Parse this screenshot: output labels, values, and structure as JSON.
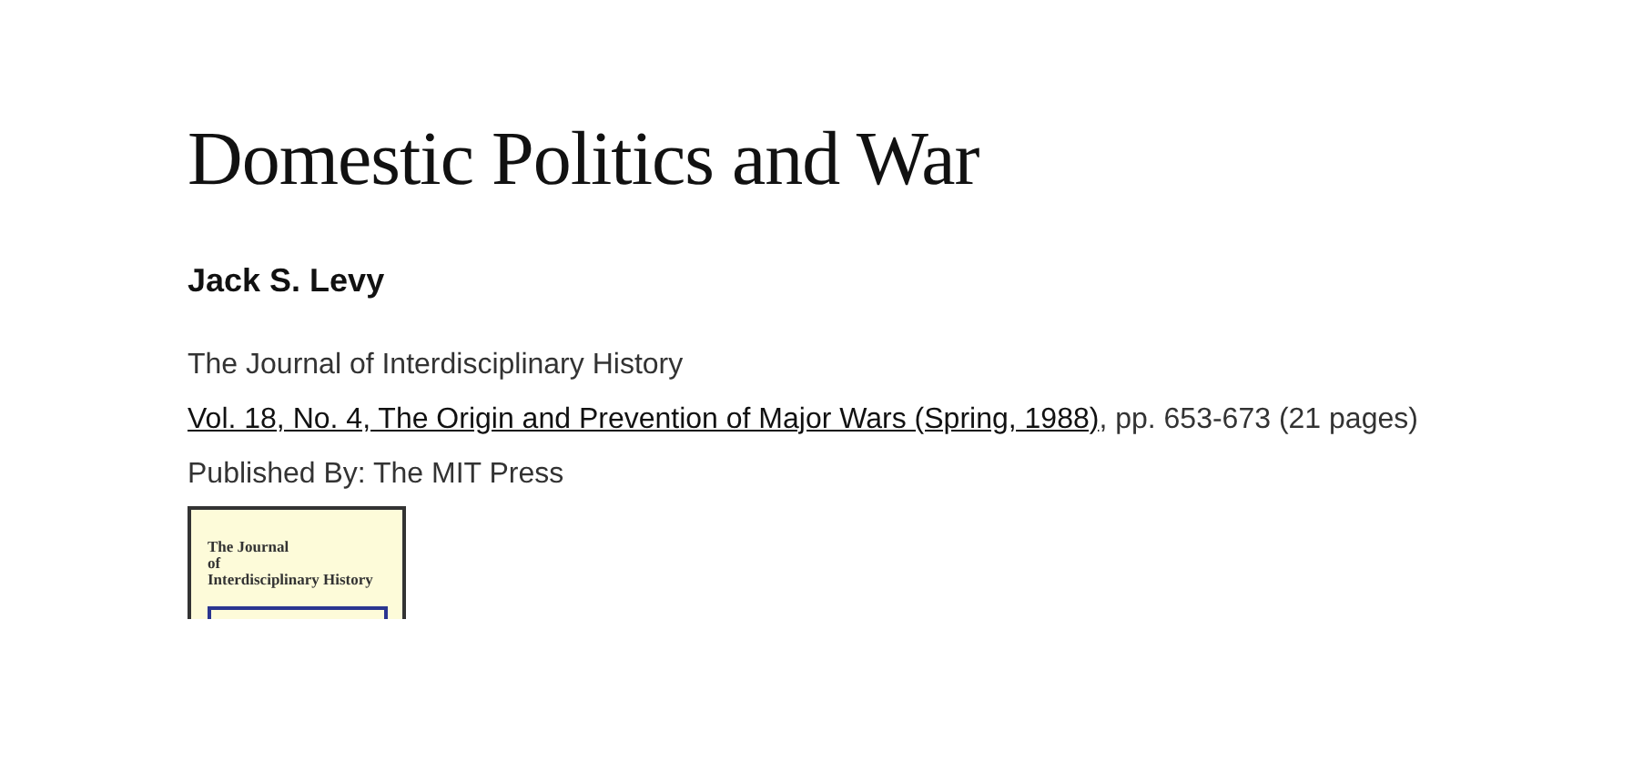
{
  "title": "Domestic Politics and War",
  "author": "Jack S. Levy",
  "journal": "The Journal of Interdisciplinary History",
  "issue": {
    "link": "Vol. 18, No. 4, The Origin and Prevention of Major Wars (Spring, 1988)",
    "rest": ", pp. 653-673 (21 pages)"
  },
  "publisher": "Published By: The MIT Press",
  "cover": {
    "title_lines": [
      "The Journal",
      "of",
      "Interdisciplinary History"
    ]
  }
}
